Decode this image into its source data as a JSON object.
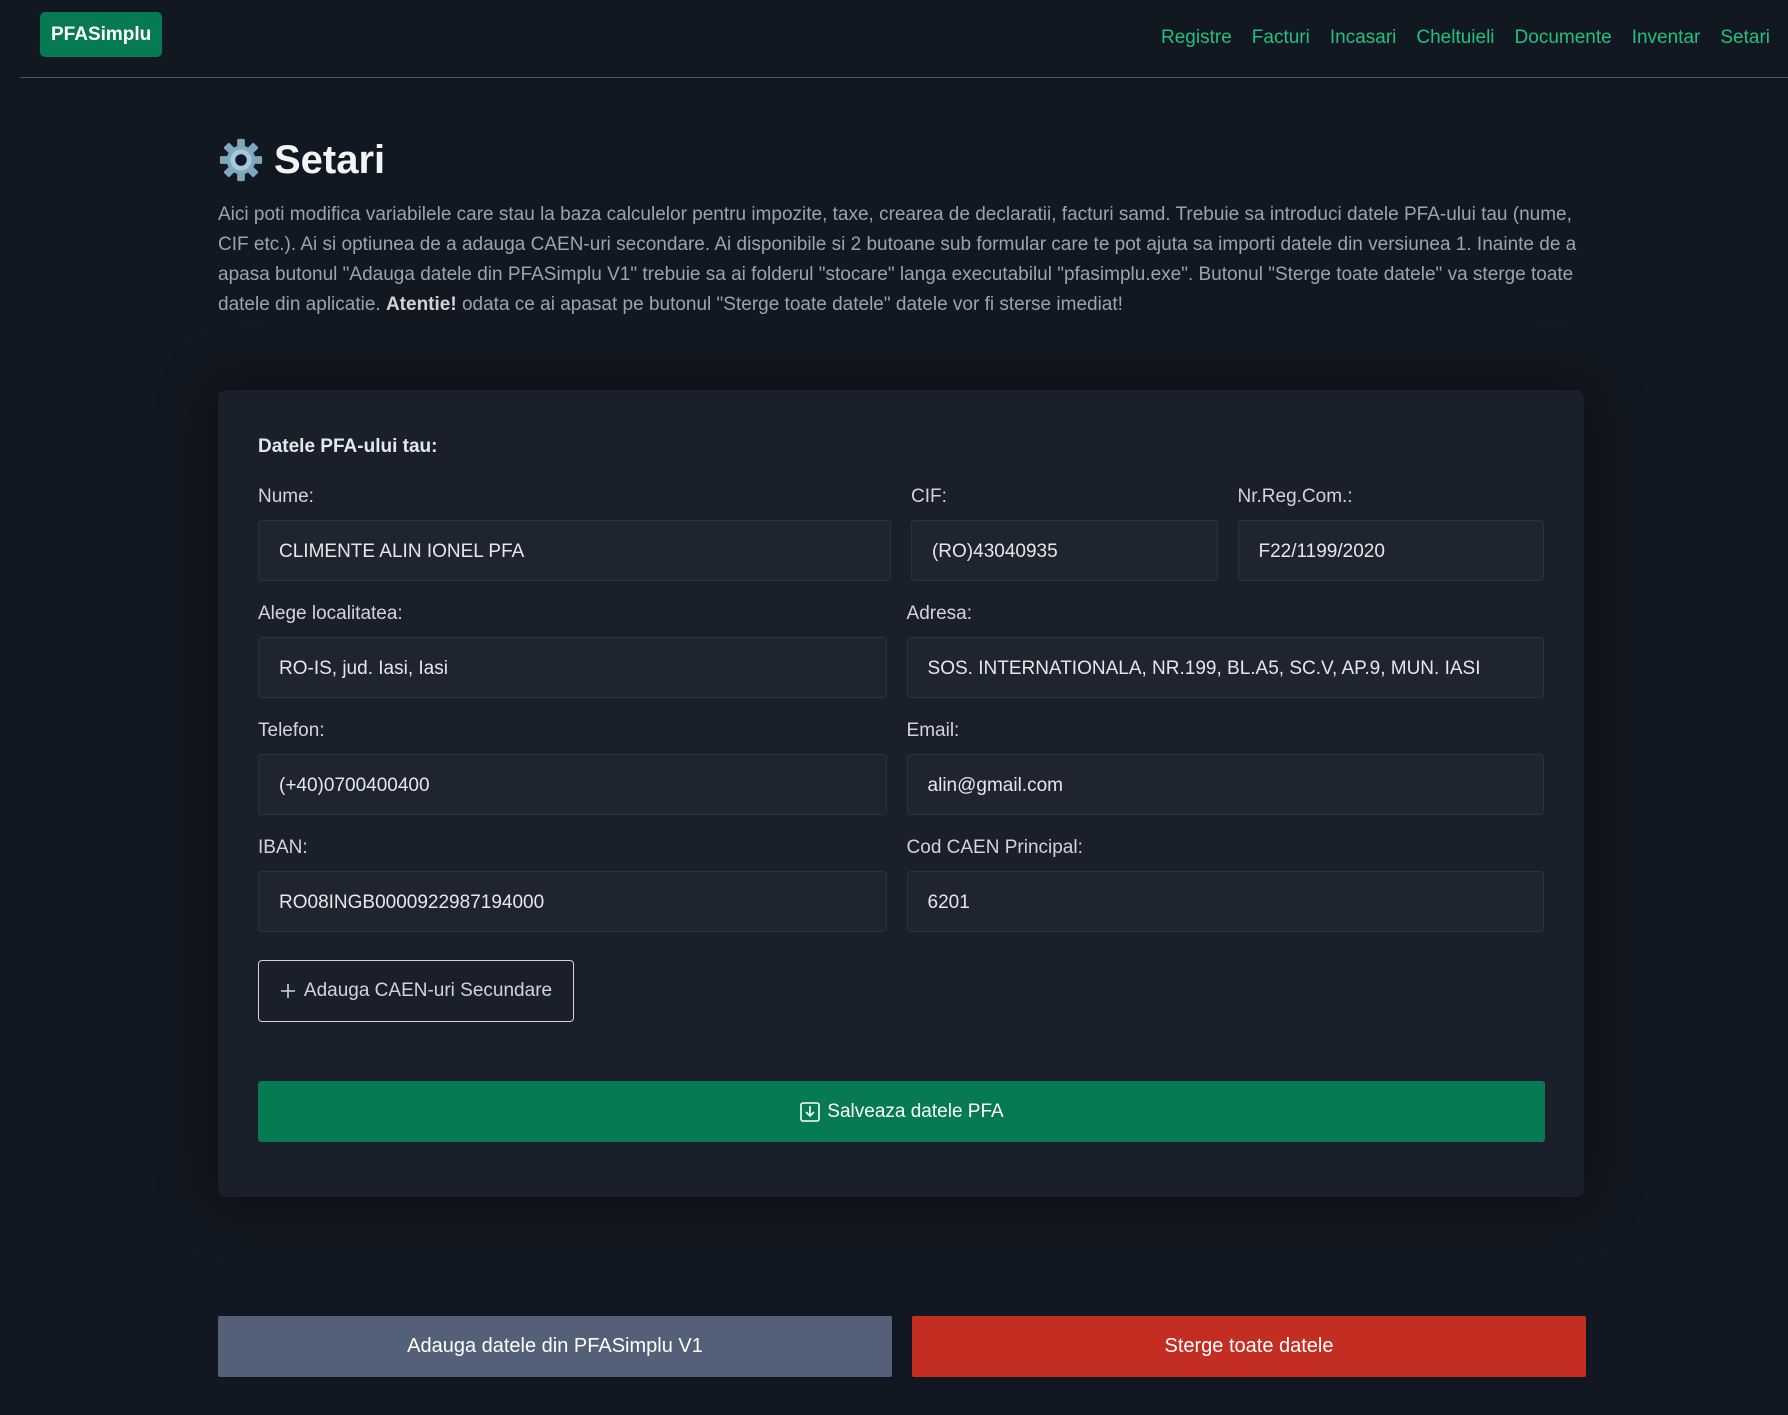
{
  "brand": "PFASimplu",
  "nav": [
    "Registre",
    "Facturi",
    "Incasari",
    "Cheltuieli",
    "Documente",
    "Inventar",
    "Setari"
  ],
  "page": {
    "title": "Setari",
    "intro_part1": "Aici poti modifica variabilele care stau la baza calculelor pentru impozite, taxe, crearea de declaratii, facturi samd. Trebuie sa introduci datele PFA-ului tau (nume, CIF etc.). Ai si optiunea de a adauga CAEN-uri secondare. Ai disponibile si 2 butoane sub formular care te pot ajuta sa importi datele din versiunea 1. Inainte de a apasa butonul \"Adauga datele din PFASimplu V1\" trebuie sa ai folderul \"stocare\" langa executabilul \"pfasimplu.exe\". Butonul \"Sterge toate datele\" va sterge toate datele din aplicatie. ",
    "intro_bold": "Atentie!",
    "intro_part2": " odata ce ai apasat pe butonul \"Sterge toate datele\" datele vor fi sterse imediat!"
  },
  "form": {
    "title": "Datele PFA-ului tau:",
    "nume_label": "Nume:",
    "nume_value": "CLIMENTE ALIN IONEL PFA",
    "cif_label": "CIF:",
    "cif_value": "(RO)43040935",
    "regcom_label": "Nr.Reg.Com.:",
    "regcom_value": "F22/1199/2020",
    "localitate_label": "Alege localitatea:",
    "localitate_value": "RO-IS, jud. Iasi, Iasi",
    "adresa_label": "Adresa:",
    "adresa_value": "SOS. INTERNATIONALA, NR.199, BL.A5, SC.V, AP.9, MUN. IASI",
    "telefon_label": "Telefon:",
    "telefon_value": "(+40)0700400400",
    "email_label": "Email:",
    "email_value": "alin@gmail.com",
    "iban_label": "IBAN:",
    "iban_value": "RO08INGB0000922987194000",
    "caen_label": "Cod CAEN Principal:",
    "caen_value": "6201",
    "add_caen_button": "Adauga CAEN-uri Secundare",
    "save_button": "Salveaza datele PFA"
  },
  "actions": {
    "import_button": "Adauga datele din PFASimplu V1",
    "delete_button": "Sterge toate datele"
  },
  "colors": {
    "accent": "#067a52",
    "nav_link": "#22c07e",
    "danger": "#c42d22",
    "secondary": "#536078"
  },
  "icons": {
    "title_icon": "gear-icon",
    "add_icon": "plus-icon",
    "save_icon": "download-icon"
  }
}
